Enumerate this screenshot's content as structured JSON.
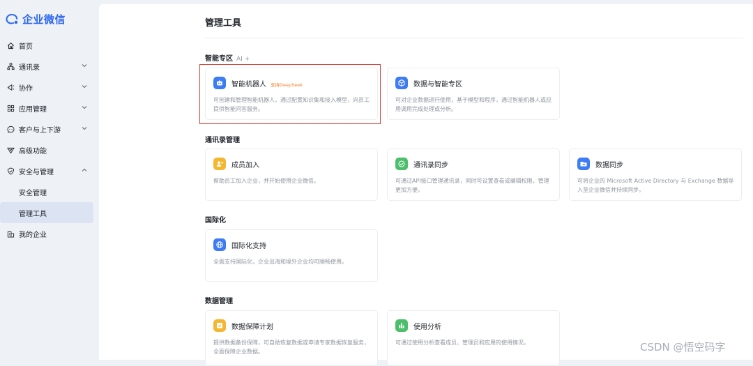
{
  "app": {
    "name": "企业微信"
  },
  "sidebar": {
    "items": [
      {
        "label": "首页",
        "icon": "home-icon",
        "expandable": false
      },
      {
        "label": "通讯录",
        "icon": "org-chart-icon",
        "expandable": true
      },
      {
        "label": "协作",
        "icon": "collaboration-icon",
        "expandable": true
      },
      {
        "label": "应用管理",
        "icon": "app-grid-icon",
        "expandable": true
      },
      {
        "label": "客户与上下游",
        "icon": "chat-bubble-icon",
        "expandable": true
      },
      {
        "label": "高级功能",
        "icon": "diamond-icon",
        "expandable": false
      },
      {
        "label": "安全与管理",
        "icon": "shield-icon",
        "expandable": true,
        "expanded": true
      },
      {
        "label": "安全管理",
        "sub": true
      },
      {
        "label": "管理工具",
        "sub": true,
        "active": true
      },
      {
        "label": "我的企业",
        "icon": "building-icon",
        "expandable": false
      }
    ]
  },
  "page": {
    "title": "管理工具"
  },
  "sections": {
    "ai": {
      "title": "智能专区",
      "tag": "AI +"
    },
    "contacts": {
      "title": "通讯录管理"
    },
    "intl": {
      "title": "国际化"
    },
    "data": {
      "title": "数据管理"
    }
  },
  "cards": {
    "robot": {
      "title": "智能机器人",
      "badge": "支持DeepSeek",
      "desc": "可创建和管理智能机器人，通过配置知识集和接入模型，向员工提供智能问答服务。",
      "color": "#3d7cf5"
    },
    "data_ai": {
      "title": "数据与智能专区",
      "desc": "可对企业数据进行使用，基于模型和程序，通过智能机器人或应用调用完成处理或分析。",
      "color": "#3d7cf5"
    },
    "member_join": {
      "title": "成员加入",
      "desc": "帮助员工加入企业，并开始使用企业微信。",
      "color": "#f5b731"
    },
    "contacts_sync": {
      "title": "通讯录同步",
      "desc": "可通过API接口管理通讯录，同时可设置查看或编辑权限，管理更加方便。",
      "color": "#4bbf6b"
    },
    "data_sync": {
      "title": "数据同步",
      "desc": "可将企业的 Microsoft Active Directory 与 Exchange 数据导入至企业微信并持续同步。",
      "color": "#3d7cf5"
    },
    "intl_support": {
      "title": "国际化支持",
      "desc": "全面支持国际化，企业出海和境外企业均可顺畅使用。",
      "color": "#3d7cf5"
    },
    "data_protect": {
      "title": "数据保障计划",
      "desc": "提供数据备份保障，可自助恢复数据或申请专家数据恢复服务，全面保障企业数据。",
      "color": "#f5b731"
    },
    "usage": {
      "title": "使用分析",
      "desc": "可通过使用分析查看成员、管理员和应用的使用情况。",
      "color": "#4bbf6b"
    }
  },
  "watermark": "CSDN @悟空码字"
}
